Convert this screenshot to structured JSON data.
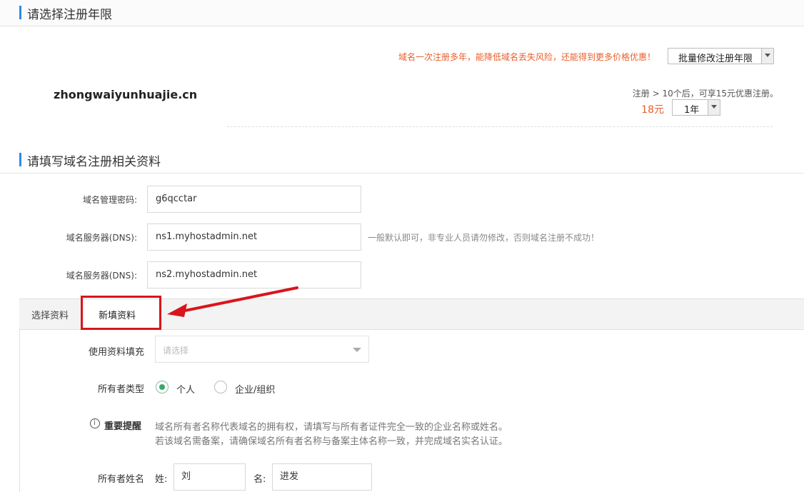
{
  "section1": {
    "title": "请选择注册年限",
    "notice": "域名一次注册多年，能降低域名丢失风险，还能得到更多价格优惠！",
    "batch_select": "批量修改注册年限"
  },
  "domain_row": {
    "domain": "zhongwaiyunhuajie.cn",
    "discount_note": "注册 > 10个后，可享15元优惠注册。",
    "price": "18元",
    "year_select": "1年"
  },
  "section2": {
    "title": "请填写域名注册相关资料",
    "fields": [
      {
        "label": "域名管理密码:",
        "value": "g6qcctar"
      },
      {
        "label": "域名服务器(DNS):",
        "value": "ns1.myhostadmin.net"
      },
      {
        "label": "域名服务器(DNS):",
        "value": "ns2.myhostadmin.net"
      }
    ],
    "dns_hint": "一般默认即可，非专业人员请勿修改，否则域名注册不成功！"
  },
  "tabs": [
    {
      "label": "选择资料"
    },
    {
      "label": "新填资料"
    }
  ],
  "form": {
    "fill_label": "使用资料填充",
    "fill_placeholder": "请选择",
    "owner_type_label": "所有者类型",
    "owner_type_options": [
      "个人",
      "企业/组织"
    ],
    "owner_type_selected": "个人",
    "reminder_label": "重要提醒",
    "reminder_line1": "域名所有者名称代表域名的拥有权，请填写与所有者证件完全一致的企业名称或姓名。",
    "reminder_line2": "若该域名需备案，请确保域名所有者名称与备案主体名称一致，并完成域名实名认证。",
    "owner_name_label": "所有者姓名",
    "surname_label": "姓:",
    "surname_value": "刘",
    "given_label": "名:",
    "given_value": "进发"
  },
  "colors": {
    "accent_blue": "#2d8ae6",
    "notice_orange": "#e8602c",
    "highlight_red": "#d8161b",
    "radio_green": "#3ea66a"
  }
}
